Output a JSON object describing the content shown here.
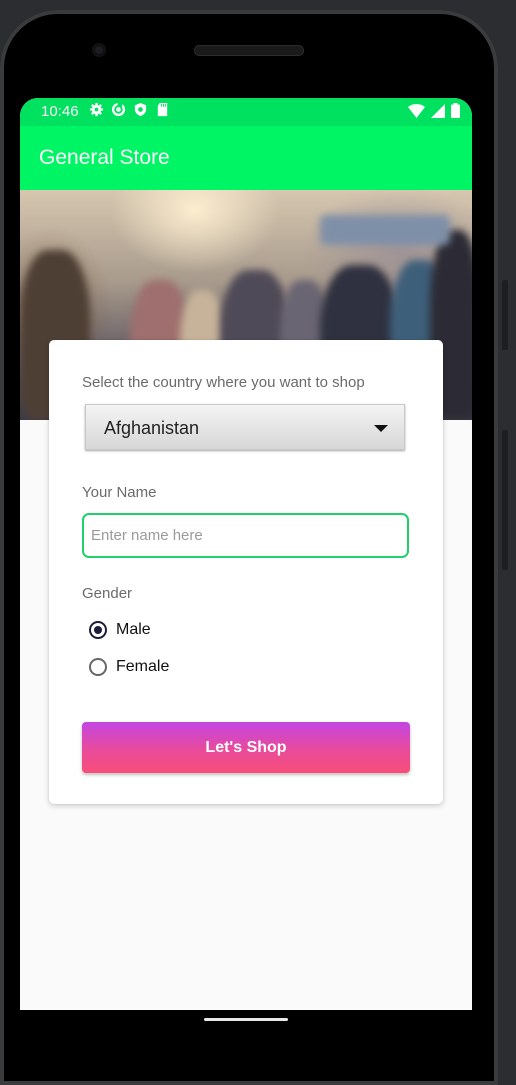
{
  "status_bar": {
    "time": "10:46",
    "left_icons": [
      "gear-icon",
      "sync-icon",
      "shield-icon",
      "sd-card-icon"
    ],
    "right_icons": [
      "wifi-icon",
      "signal-icon",
      "battery-icon"
    ]
  },
  "app_bar": {
    "title": "General Store",
    "color": "#00f564"
  },
  "form": {
    "country_label": "Select the country where you want to shop",
    "country_selected": "Afghanistan",
    "name_label": "Your Name",
    "name_placeholder": "Enter name here",
    "name_value": "",
    "gender_label": "Gender",
    "gender_options": [
      {
        "label": "Male",
        "checked": true
      },
      {
        "label": "Female",
        "checked": false
      }
    ],
    "submit_label": "Let's  Shop",
    "accent_colors": {
      "input_border": "#20d06a",
      "button_top": "#c245e3",
      "button_bottom": "#f84e79"
    }
  }
}
